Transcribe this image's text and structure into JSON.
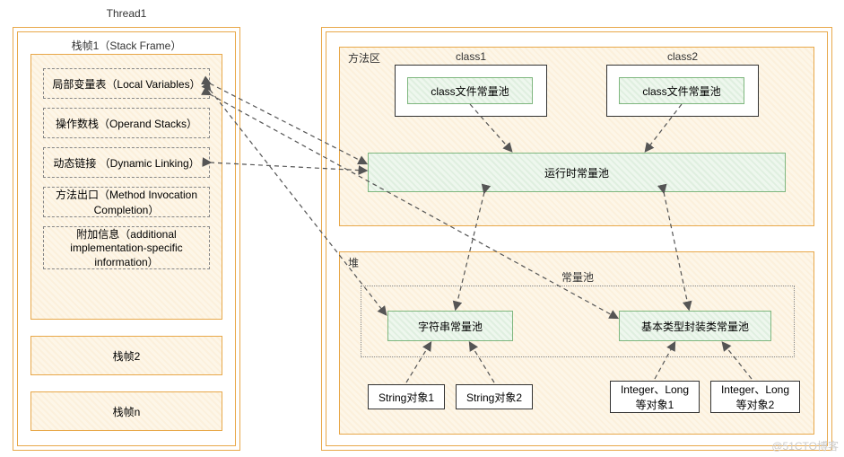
{
  "thread": {
    "title": "Thread1",
    "frame1_title": "栈帧1（Stack Frame）",
    "local_vars": "局部变量表（Local\nVariables）",
    "operand": "操作数栈（Operand\nStacks）",
    "dynamic": "动态链接 （Dynamic\nLinking）",
    "method_exit": "方法出口（Method\nInvocation Completion）",
    "extra": "附加信息（additional\nimplementation-specific\ninformation）",
    "frame2": "栈帧2",
    "frameN": "栈帧n"
  },
  "method_area": {
    "title": "方法区",
    "class1": "class1",
    "class1_pool": "class文件常量池",
    "class2": "class2",
    "class2_pool": "class文件常量池",
    "runtime_pool": "运行时常量池"
  },
  "heap": {
    "title": "堆",
    "pool_box_title": "常量池",
    "string_pool": "字符串常量池",
    "wrapper_pool": "基本类型封装类常量池",
    "string1": "String对象1",
    "string2": "String对象2",
    "integer1": "Integer、Long\n等对象1",
    "integer2": "Integer、Long\n等对象2"
  },
  "watermark": "@51CTO博客"
}
